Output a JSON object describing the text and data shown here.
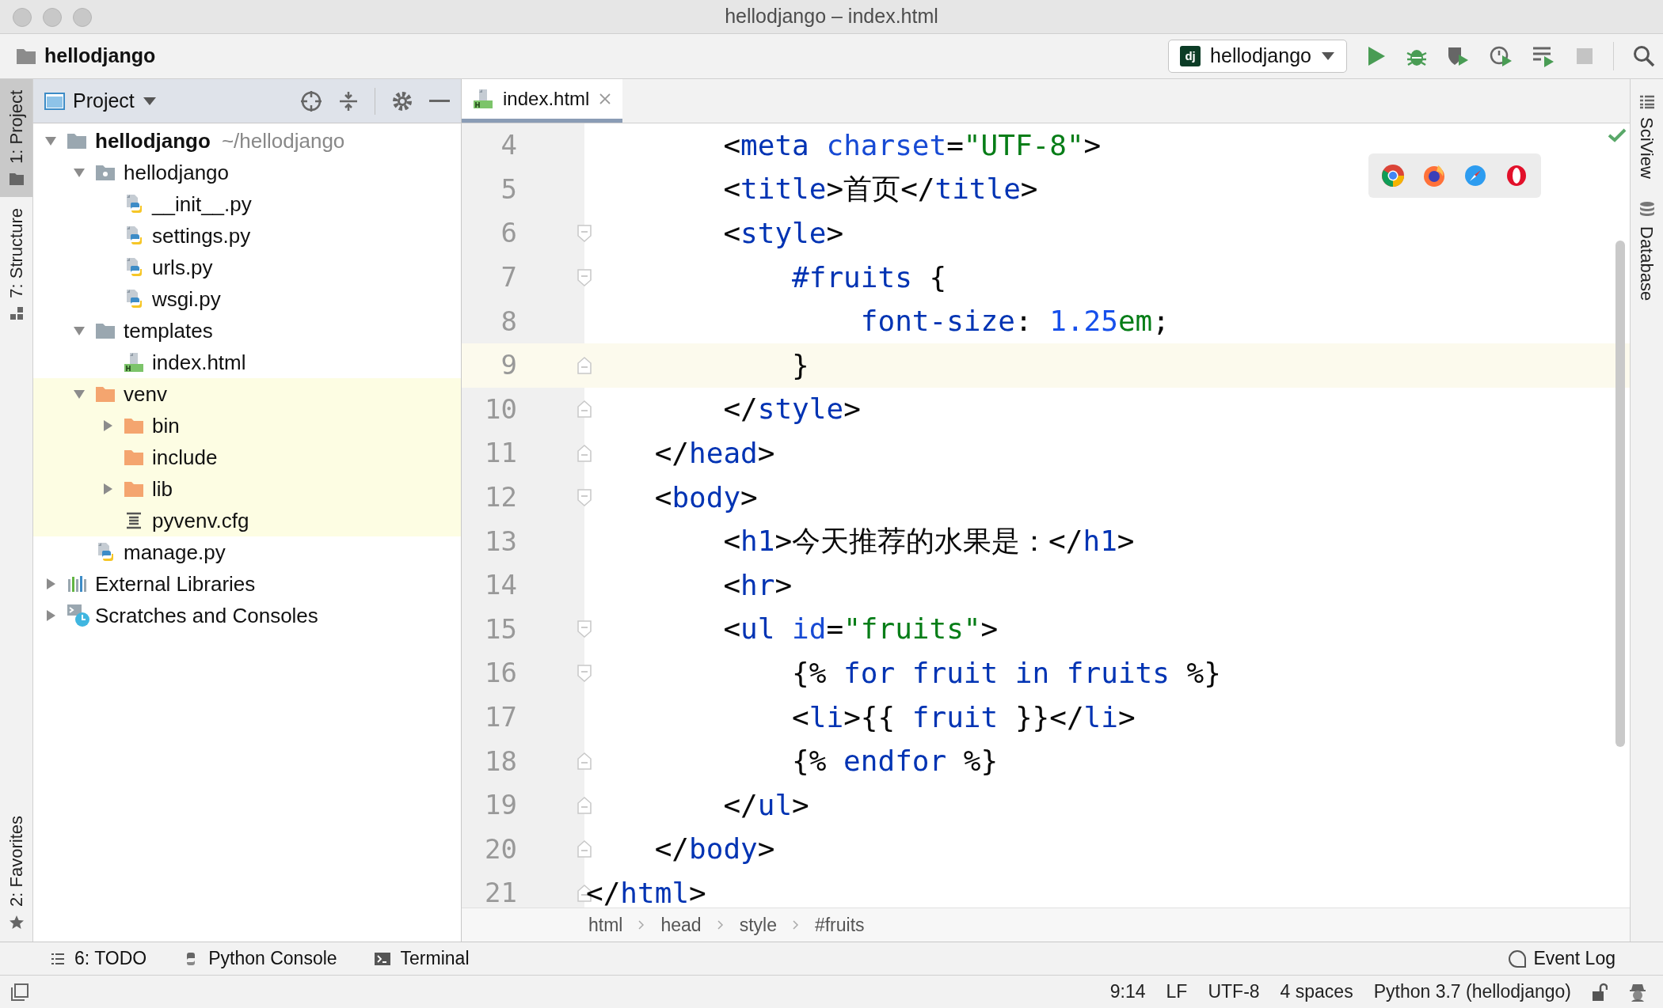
{
  "window": {
    "title": "hellodjango – index.html"
  },
  "toolbar": {
    "project": "hellodjango",
    "run_config": {
      "badge": "dj",
      "label": "hellodjango"
    }
  },
  "left_strip": [
    {
      "label": "1: Project",
      "kind": "project",
      "selected": true
    },
    {
      "label": "7: Structure",
      "kind": "structure",
      "selected": false
    }
  ],
  "left_strip_bottom": [
    {
      "label": "2: Favorites",
      "kind": "favorites",
      "selected": false
    }
  ],
  "project_panel": {
    "title": "Project",
    "tree": [
      {
        "label": "hellodjango",
        "path": "~/hellodjango",
        "kind": "folder",
        "expanded": true,
        "excluded": false,
        "children": [
          {
            "label": "hellodjango",
            "kind": "package",
            "expanded": true,
            "excluded": false,
            "children": [
              {
                "label": "__init__.py",
                "kind": "python",
                "excluded": false
              },
              {
                "label": "settings.py",
                "kind": "python",
                "excluded": false
              },
              {
                "label": "urls.py",
                "kind": "python",
                "excluded": false
              },
              {
                "label": "wsgi.py",
                "kind": "python",
                "excluded": false
              }
            ]
          },
          {
            "label": "templates",
            "kind": "folder",
            "expanded": true,
            "excluded": false,
            "children": [
              {
                "label": "index.html",
                "kind": "html",
                "excluded": false
              }
            ]
          },
          {
            "label": "venv",
            "kind": "excluded-folder",
            "expanded": true,
            "excluded": true,
            "children": [
              {
                "label": "bin",
                "kind": "excluded-folder",
                "expanded": false,
                "excluded": true
              },
              {
                "label": "include",
                "kind": "excluded-folder",
                "excluded": true
              },
              {
                "label": "lib",
                "kind": "excluded-folder",
                "expanded": false,
                "excluded": true
              },
              {
                "label": "pyvenv.cfg",
                "kind": "config",
                "excluded": true
              }
            ]
          },
          {
            "label": "manage.py",
            "kind": "python",
            "excluded": false
          }
        ]
      },
      {
        "label": "External Libraries",
        "kind": "libraries",
        "expanded": false,
        "excluded": false
      },
      {
        "label": "Scratches and Consoles",
        "kind": "scratches",
        "expanded": false,
        "excluded": false
      }
    ]
  },
  "editor": {
    "tabs": [
      {
        "label": "index.html",
        "selected": true
      }
    ],
    "lines": [
      {
        "number": "4",
        "kind": "plain",
        "current": false,
        "tokens": [
          {
            "kind": "plain",
            "text": "        <"
          },
          {
            "kind": "tag",
            "text": "meta"
          },
          {
            "kind": "attr",
            "text": " charset"
          },
          {
            "kind": "plain",
            "text": "="
          },
          {
            "kind": "string",
            "text": "\"UTF-8\""
          },
          {
            "kind": "plain",
            "text": ">"
          }
        ]
      },
      {
        "number": "5",
        "kind": "plain",
        "current": false,
        "tokens": [
          {
            "kind": "plain",
            "text": "        <"
          },
          {
            "kind": "tag",
            "text": "title"
          },
          {
            "kind": "plain",
            "text": ">首页</"
          },
          {
            "kind": "tag",
            "text": "title"
          },
          {
            "kind": "plain",
            "text": ">"
          }
        ]
      },
      {
        "number": "6",
        "kind": "opening",
        "current": false,
        "tokens": [
          {
            "kind": "plain",
            "text": "        <"
          },
          {
            "kind": "tag",
            "text": "style"
          },
          {
            "kind": "plain",
            "text": ">"
          }
        ]
      },
      {
        "number": "7",
        "kind": "opening",
        "current": false,
        "tokens": [
          {
            "kind": "tag",
            "text": "            #fruits"
          },
          {
            "kind": "plain",
            "text": " {"
          }
        ]
      },
      {
        "number": "8",
        "kind": "plain",
        "current": false,
        "tokens": [
          {
            "kind": "tag",
            "text": "                font-size"
          },
          {
            "kind": "plain",
            "text": ": "
          },
          {
            "kind": "number",
            "text": "1.25"
          },
          {
            "kind": "string",
            "text": "em"
          },
          {
            "kind": "plain",
            "text": ";"
          }
        ]
      },
      {
        "number": "9",
        "kind": "closing",
        "current": true,
        "tokens": [
          {
            "kind": "plain",
            "text": "            }"
          }
        ]
      },
      {
        "number": "10",
        "kind": "closing",
        "current": false,
        "tokens": [
          {
            "kind": "plain",
            "text": "        </"
          },
          {
            "kind": "tag",
            "text": "style"
          },
          {
            "kind": "plain",
            "text": ">"
          }
        ]
      },
      {
        "number": "11",
        "kind": "closing",
        "current": false,
        "tokens": [
          {
            "kind": "plain",
            "text": "    </"
          },
          {
            "kind": "tag",
            "text": "head"
          },
          {
            "kind": "plain",
            "text": ">"
          }
        ]
      },
      {
        "number": "12",
        "kind": "opening",
        "current": false,
        "tokens": [
          {
            "kind": "plain",
            "text": "    <"
          },
          {
            "kind": "tag",
            "text": "body"
          },
          {
            "kind": "plain",
            "text": ">"
          }
        ]
      },
      {
        "number": "13",
        "kind": "plain",
        "current": false,
        "tokens": [
          {
            "kind": "plain",
            "text": "        <"
          },
          {
            "kind": "tag",
            "text": "h1"
          },
          {
            "kind": "plain",
            "text": ">今天推荐的水果是：</"
          },
          {
            "kind": "tag",
            "text": "h1"
          },
          {
            "kind": "plain",
            "text": ">"
          }
        ]
      },
      {
        "number": "14",
        "kind": "plain",
        "current": false,
        "tokens": [
          {
            "kind": "plain",
            "text": "        <"
          },
          {
            "kind": "tag",
            "text": "hr"
          },
          {
            "kind": "plain",
            "text": ">"
          }
        ]
      },
      {
        "number": "15",
        "kind": "opening",
        "current": false,
        "tokens": [
          {
            "kind": "plain",
            "text": "        <"
          },
          {
            "kind": "tag",
            "text": "ul"
          },
          {
            "kind": "attr",
            "text": " id"
          },
          {
            "kind": "plain",
            "text": "="
          },
          {
            "kind": "string",
            "text": "\"fruits\""
          },
          {
            "kind": "plain",
            "text": ">"
          }
        ]
      },
      {
        "number": "16",
        "kind": "opening",
        "current": false,
        "tokens": [
          {
            "kind": "plain",
            "text": "            {% "
          },
          {
            "kind": "tag",
            "text": "for fruit in fruits"
          },
          {
            "kind": "plain",
            "text": " %}"
          }
        ]
      },
      {
        "number": "17",
        "kind": "plain",
        "current": false,
        "tokens": [
          {
            "kind": "plain",
            "text": "            <"
          },
          {
            "kind": "tag",
            "text": "li"
          },
          {
            "kind": "plain",
            "text": ">{{ "
          },
          {
            "kind": "tag",
            "text": "fruit"
          },
          {
            "kind": "plain",
            "text": " }}</"
          },
          {
            "kind": "tag",
            "text": "li"
          },
          {
            "kind": "plain",
            "text": ">"
          }
        ]
      },
      {
        "number": "18",
        "kind": "closing",
        "current": false,
        "tokens": [
          {
            "kind": "plain",
            "text": "            {% "
          },
          {
            "kind": "tag",
            "text": "endfor"
          },
          {
            "kind": "plain",
            "text": " %}"
          }
        ]
      },
      {
        "number": "19",
        "kind": "closing",
        "current": false,
        "tokens": [
          {
            "kind": "plain",
            "text": "        </"
          },
          {
            "kind": "tag",
            "text": "ul"
          },
          {
            "kind": "plain",
            "text": ">"
          }
        ]
      },
      {
        "number": "20",
        "kind": "closing",
        "current": false,
        "tokens": [
          {
            "kind": "plain",
            "text": "    </"
          },
          {
            "kind": "tag",
            "text": "body"
          },
          {
            "kind": "plain",
            "text": ">"
          }
        ]
      },
      {
        "number": "21",
        "kind": "closing",
        "current": false,
        "tokens": [
          {
            "kind": "plain",
            "text": "</"
          },
          {
            "kind": "tag",
            "text": "html"
          },
          {
            "kind": "plain",
            "text": ">"
          }
        ]
      }
    ],
    "breadcrumbs": [
      "html",
      "head",
      "style",
      "#fruits"
    ]
  },
  "right_strip": [
    {
      "label": "SciView",
      "kind": "sciview"
    },
    {
      "label": "Database",
      "kind": "database"
    }
  ],
  "tool_bar": [
    {
      "label": "6: TODO",
      "kind": "todo"
    },
    {
      "label": "Python Console",
      "kind": "python"
    },
    {
      "label": "Terminal",
      "kind": "terminal"
    }
  ],
  "event_log": "Event Log",
  "status_bar": [
    "9:14",
    "LF",
    "UTF-8",
    "4 spaces",
    "Python 3.7 (hellodjango)"
  ]
}
